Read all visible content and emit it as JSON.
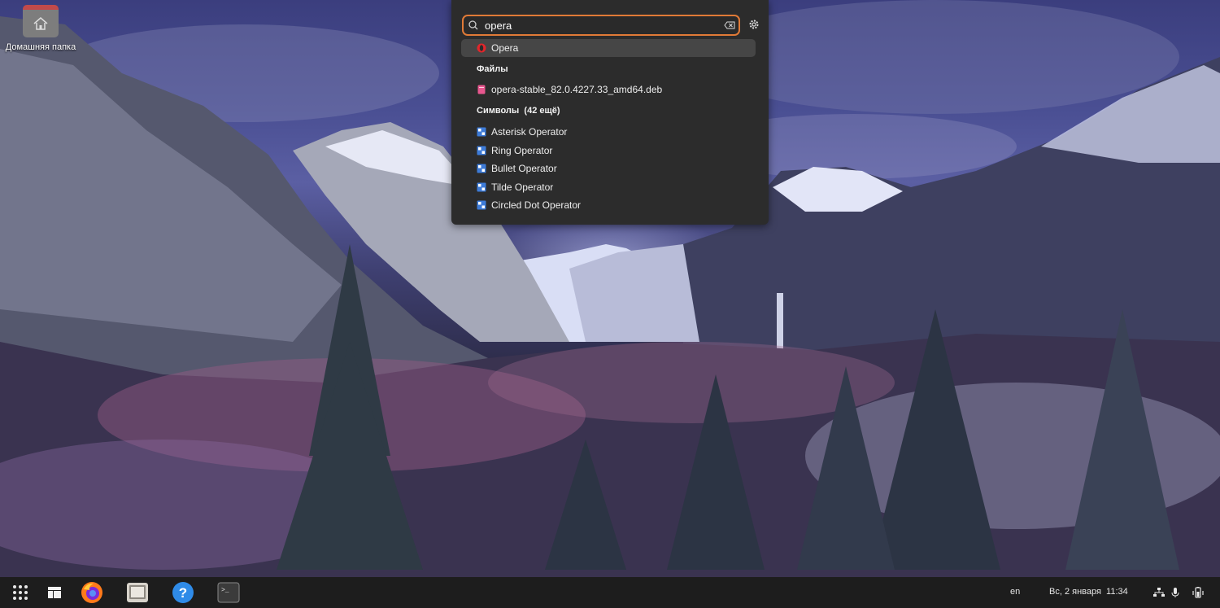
{
  "desktop": {
    "home_folder_label": "Домашняя папка"
  },
  "search": {
    "query": "opera",
    "selected_app": "Opera",
    "files_header": "Файлы",
    "file_item": "opera-stable_82.0.4227.33_amd64.deb",
    "symbols_header": "Символы",
    "symbols_more": "(42 ещё)",
    "symbols": [
      "Asterisk Operator",
      "Ring Operator",
      "Bullet Operator",
      "Tilde Operator",
      "Circled Dot Operator"
    ]
  },
  "taskbar": {
    "apps": [
      "apps-grid-icon",
      "workspace-icon",
      "firefox-icon",
      "files-icon",
      "help-icon",
      "terminal-icon"
    ],
    "help_glyph": "?",
    "terminal_glyph": ">_"
  },
  "tray": {
    "language": "en",
    "datetime": "Вс, 2 января  11:34"
  },
  "colors": {
    "accent": "#e07a37",
    "popup_bg": "#2c2c2c",
    "taskbar_bg": "#1d1d1d",
    "opera_red": "#e0262b"
  }
}
